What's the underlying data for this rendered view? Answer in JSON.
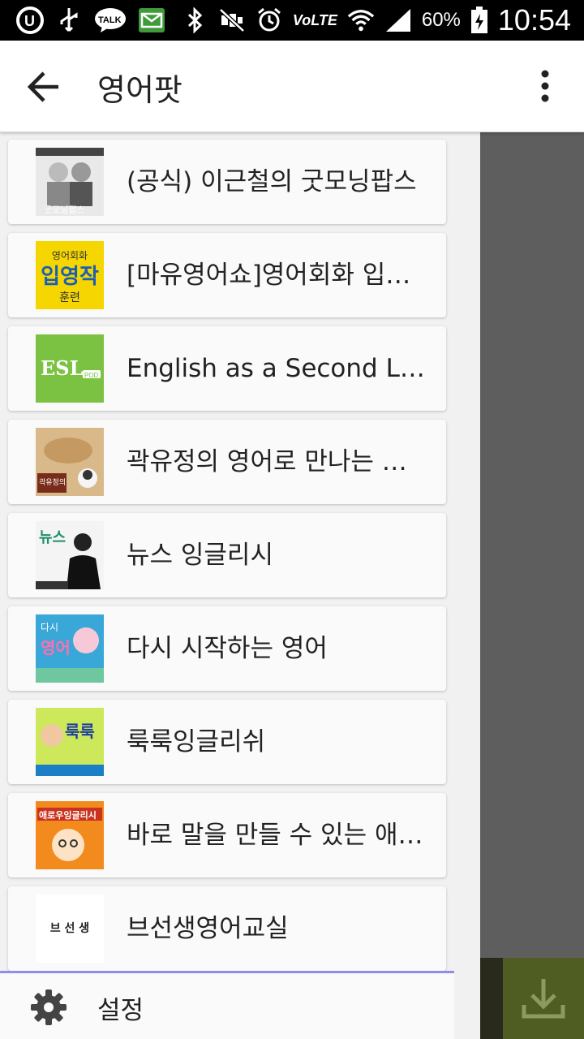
{
  "status_bar": {
    "battery_text": "60%",
    "time": "10:54",
    "left_icons": [
      "u-plus-icon",
      "usb-icon",
      "talk-icon",
      "message-icon"
    ],
    "right_icons": [
      "bluetooth-icon",
      "mute-icon",
      "alarm-icon",
      "volte-icon",
      "wifi-icon",
      "signal-icon",
      "battery-icon"
    ],
    "talk_label": "TALK",
    "volte_label": "VoLTE"
  },
  "appbar": {
    "title": "영어팟"
  },
  "drawer": {
    "items": [
      {
        "label": "(공식) 이근철의 굿모닝팝스",
        "thumb_text": "굿모닝팝스",
        "color": "#e9e9e9"
      },
      {
        "label": "[마유영어쇼]영어회화 입영작 훈련",
        "thumb_text": "입영작",
        "color": "#f5d600"
      },
      {
        "label": "English as a Second Language Podcast",
        "thumb_text": "ESL",
        "color": "#7cc242"
      },
      {
        "label": "곽유정의 영어로 만나는 고전",
        "thumb_text": "곽유정의",
        "color": "#d9b98a"
      },
      {
        "label": "뉴스 잉글리시",
        "thumb_text": "뉴스",
        "color": "#f4f4f4"
      },
      {
        "label": "다시 시작하는 영어",
        "thumb_text": "영어",
        "color": "#3aa7d9"
      },
      {
        "label": "룩룩잉글리쉬",
        "thumb_text": "룩룩",
        "color": "#cde85a"
      },
      {
        "label": "바로 말을 만들 수 있는 애로우잉글리시",
        "thumb_text": "애로우잉글리시",
        "color": "#f28a1e"
      },
      {
        "label": "브선생영어교실",
        "thumb_text": "브 선 생",
        "color": "#ffffff"
      }
    ],
    "settings_label": "설정"
  },
  "colors": {
    "accent_line": "#8f8ee8",
    "fab": "#4f5c22"
  }
}
